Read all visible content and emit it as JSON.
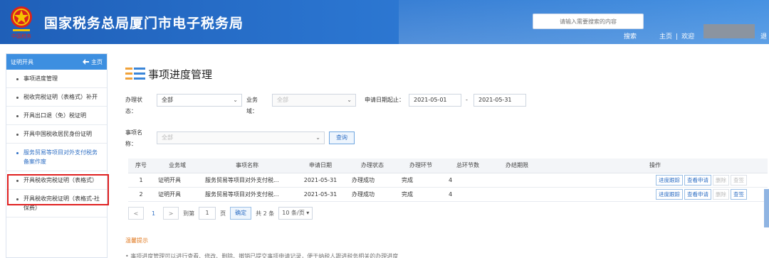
{
  "header": {
    "title": "国家税务总局厦门市电子税务局",
    "emblem_text": "中国税务",
    "search_placeholder": "请输入需要搜索的内容",
    "search_button": "搜索",
    "home_link": "主页",
    "welcome": "欢迎",
    "logout_fragment": "退"
  },
  "sidebar": {
    "header_label": "证明开具",
    "home_label": "主页",
    "items": [
      {
        "label": "事项进度管理"
      },
      {
        "label": "税收完税证明（表格式）补开"
      },
      {
        "label": "开具出口退（免）税证明"
      },
      {
        "label": "开具中国税收居民身份证明"
      },
      {
        "label": "服务贸易等项目对外支付税务备案作废"
      },
      {
        "label": "开具税收完税证明（表格式）"
      },
      {
        "label": "开具税收完税证明（表格式-社保费）"
      }
    ],
    "active_index": 4
  },
  "main": {
    "page_title": "事项进度管理",
    "filters": {
      "status_label": "办理状态：",
      "status_value": "全部",
      "business_label": "业务域：",
      "business_value": "全部",
      "date_label": "申请日期起止：",
      "date_start": "2021-05-01",
      "date_sep": "-",
      "date_end": "2021-05-31",
      "item_label": "事项名称：",
      "item_value": "全部",
      "query_button": "查询"
    },
    "table": {
      "columns": [
        "序号",
        "业务域",
        "事项名称",
        "申请日期",
        "办理状态",
        "办理环节",
        "总环节数",
        "办结期限",
        "操作"
      ],
      "rows": [
        {
          "no": "1",
          "domain": "证明开具",
          "name": "服务贸易等项目对外支付税...",
          "date": "2021-05-31",
          "status": "办理成功",
          "step": "完成",
          "total": "4",
          "deadline": ""
        },
        {
          "no": "2",
          "domain": "证明开具",
          "name": "服务贸易等项目对外支付税...",
          "date": "2021-05-31",
          "status": "办理成功",
          "step": "完成",
          "total": "4",
          "deadline": ""
        }
      ],
      "actions": [
        "进度跟踪",
        "查看申请",
        "删除",
        "查签"
      ]
    },
    "pager": {
      "current": "1",
      "goto_label": "到第",
      "goto_value": "1",
      "page_unit": "页",
      "confirm": "确定",
      "total_text": "共 2 条",
      "page_size": "10 条/页"
    },
    "tip_title": "温馨提示",
    "tip_line": "• 事项进度管理可以进行查看、修改、删除、撤销已提交事项申请记录，便于纳税人跟进税务相关的办理进度"
  },
  "colors": {
    "header_blue": "#2a74cf",
    "sidebar_head": "#3d8fe0",
    "link_blue": "#2f6fc4",
    "tip_orange": "#e0781e",
    "highlight_red": "#e02020"
  }
}
